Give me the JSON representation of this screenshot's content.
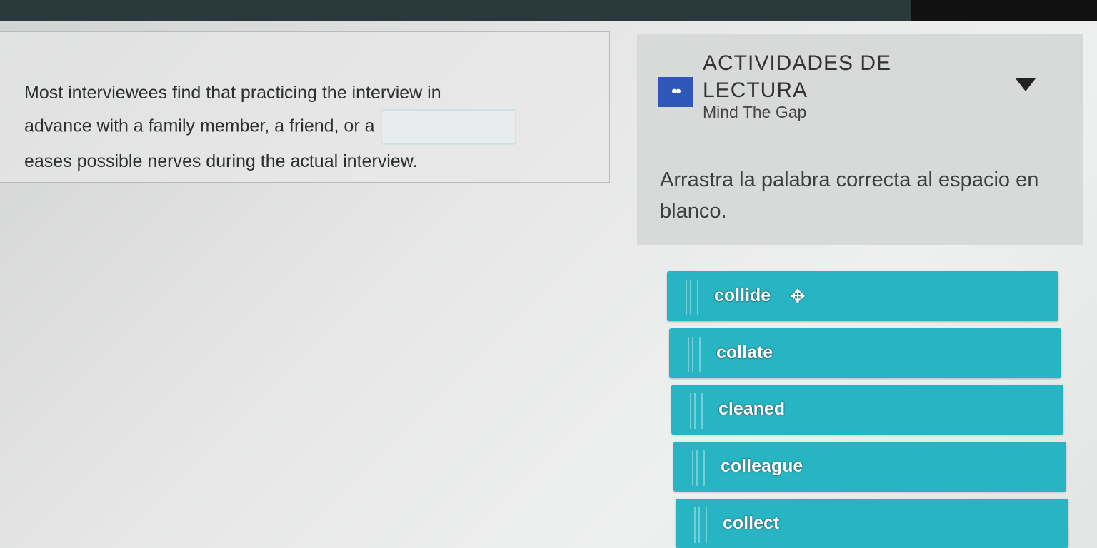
{
  "question": {
    "line1": "Most interviewees find that practicing the interview in",
    "line2": "advance with a family member, a friend, or a",
    "line3": "eases possible nerves during the actual interview."
  },
  "panel": {
    "title": "ACTIVIDADES DE LECTURA",
    "subtitle": "Mind The Gap",
    "icon": "glasses-icon",
    "instruction": "Arrastra la palabra correcta al espacio en blanco."
  },
  "words": [
    "collide",
    "collate",
    "cleaned",
    "colleague",
    "collect"
  ],
  "colors": {
    "word_bg": "#27b5c3",
    "icon_bg": "#2e57b8"
  }
}
